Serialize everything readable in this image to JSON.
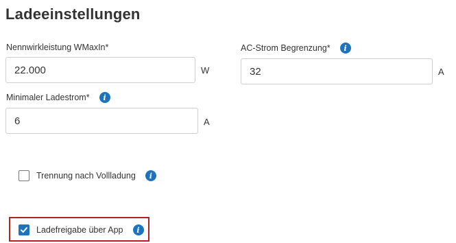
{
  "section": {
    "title": "Ladeeinstellungen"
  },
  "fields": {
    "nominal_power": {
      "label": "Nennwirkleistung WMaxIn*",
      "value": "22.000",
      "unit": "W"
    },
    "ac_current_limit": {
      "label": "AC-Strom Begrenzung*",
      "value": "32",
      "unit": "A",
      "info_icon": "info-icon"
    },
    "min_charging_current": {
      "label": "Minimaler Ladestrom*",
      "value": "6",
      "unit": "A",
      "info_icon": "info-icon"
    }
  },
  "checkboxes": {
    "disconnect_after_full": {
      "label": "Trennung nach Vollladung",
      "checked": false,
      "info_icon": "info-icon"
    },
    "charge_release_app": {
      "label": "Ladefreigabe über App",
      "checked": true,
      "info_icon": "info-icon",
      "highlighted": true
    }
  },
  "colors": {
    "accent": "#1e73be",
    "highlight_border": "#b22222",
    "input_border": "#cfcfcf",
    "text": "#333333"
  },
  "info_glyph": "i"
}
